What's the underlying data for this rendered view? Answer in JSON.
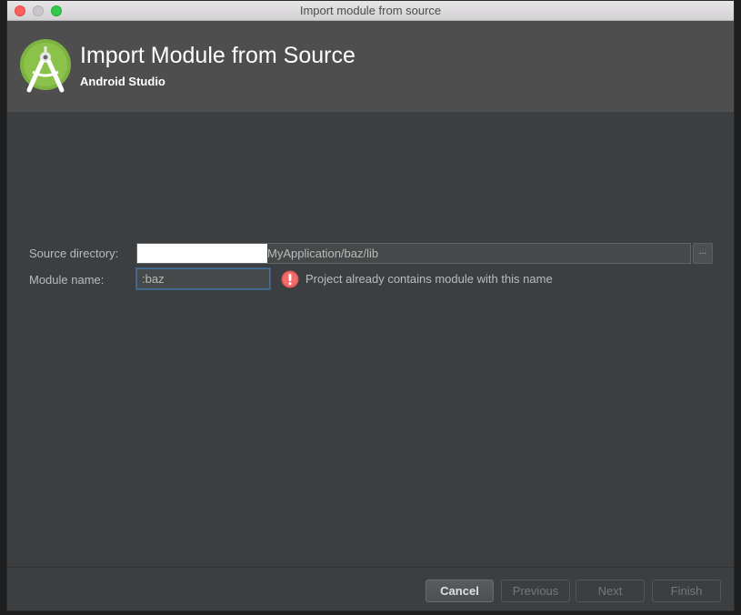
{
  "window": {
    "title": "Import module from source"
  },
  "header": {
    "title": "Import Module from Source",
    "subtitle": "Android Studio",
    "logo_icon": "android-studio-logo-icon"
  },
  "form": {
    "source_directory": {
      "label": "Source directory:",
      "value": "MyApplication/baz/lib",
      "browse_label": "..."
    },
    "module_name": {
      "label": "Module name:",
      "value": ":baz"
    },
    "error": {
      "icon": "error-icon",
      "message": "Project already contains module with this name"
    }
  },
  "footer": {
    "cancel_label": "Cancel",
    "previous_label": "Previous",
    "next_label": "Next",
    "finish_label": "Finish"
  },
  "colors": {
    "header_bg": "#4e4e4e",
    "body_bg": "#3c3f41",
    "error_red": "#e05555",
    "android_green": "#a4c639"
  }
}
